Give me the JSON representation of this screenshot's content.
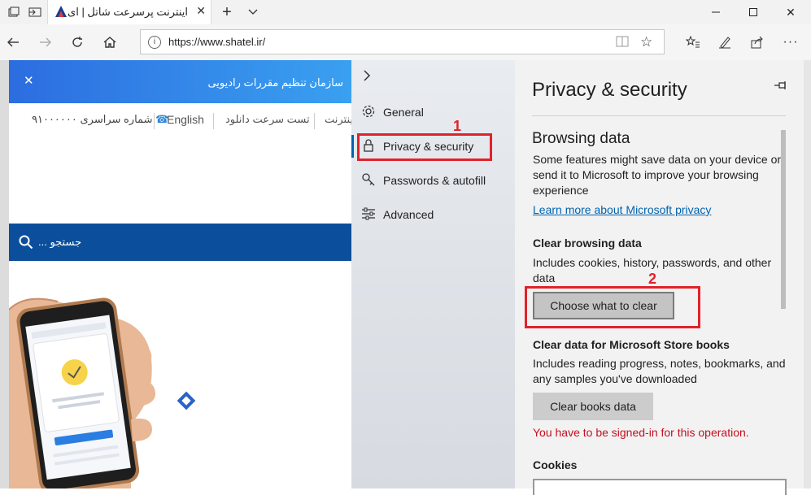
{
  "browser": {
    "tab_title": "اینترنت پرسرعت شاتل | ای",
    "address": "https://www.shatel.ir/"
  },
  "site": {
    "banner_text": "سازمان تنظیم مقررات رادیویی",
    "nav": {
      "phone": "شماره سراسری ۹۱۰۰۰۰۰۰",
      "english": "English",
      "speed_test": "تست سرعت دانلود",
      "internet": "اینترنت"
    },
    "search_placeholder": "جستجو ..."
  },
  "settings_menu": {
    "items": [
      {
        "label": "General",
        "icon": "gear-icon"
      },
      {
        "label": "Privacy & security",
        "icon": "lock-icon"
      },
      {
        "label": "Passwords & autofill",
        "icon": "key-icon"
      },
      {
        "label": "Advanced",
        "icon": "sliders-icon"
      }
    ],
    "selected": "Privacy & security"
  },
  "annotations": {
    "step1": "1",
    "step2": "2",
    "highlight_color": "#e0222a"
  },
  "panel": {
    "title": "Privacy & security",
    "browsing_data": {
      "heading": "Browsing data",
      "description": "Some features might save data on your device or send it to Microsoft to improve your browsing experience",
      "link": "Learn more about Microsoft privacy"
    },
    "clear_browsing": {
      "heading": "Clear browsing data",
      "description": "Includes cookies, history, passwords, and other data",
      "button": "Choose what to clear"
    },
    "store_books": {
      "heading": "Clear data for Microsoft Store books",
      "description": "Includes reading progress, notes, bookmarks, and any samples you've downloaded",
      "button": "Clear books data",
      "warning": "You have to be signed-in for this operation."
    },
    "cookies": {
      "heading": "Cookies"
    }
  },
  "colors": {
    "accent": "#0063b1",
    "banner": "#2c6de0",
    "search_bar": "#0b4f9c",
    "warning": "#c50f1f"
  }
}
